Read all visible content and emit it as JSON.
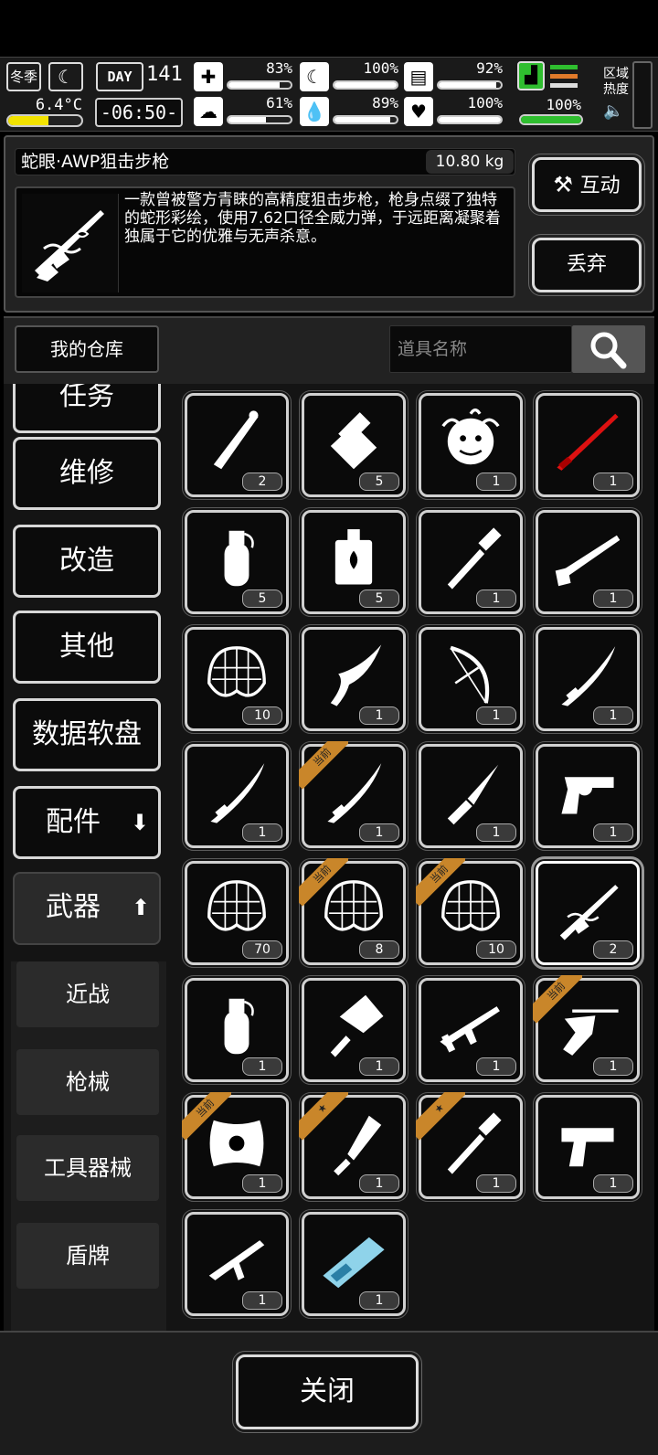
{
  "status": {
    "season": "冬季",
    "temperature": "6.4°C",
    "temperature_level": 0.55,
    "day_label": "DAY",
    "day_number": "141",
    "time": "-06:50-",
    "stats": [
      {
        "icon": "medkit-icon",
        "glyph": "✚",
        "value": "83%",
        "level": 0.83
      },
      {
        "icon": "hunger-icon",
        "glyph": "☾",
        "value": "100%",
        "level": 1.0
      },
      {
        "icon": "energy-icon",
        "glyph": "▤",
        "value": "92%",
        "level": 0.92
      },
      {
        "icon": "mood-icon",
        "glyph": "☁",
        "value": "61%",
        "level": 0.61
      },
      {
        "icon": "water-icon",
        "glyph": "💧",
        "value": "89%",
        "level": 0.89
      },
      {
        "icon": "heart-icon",
        "glyph": "♥",
        "value": "100%",
        "level": 1.0
      }
    ],
    "stamina_value": "100%",
    "stamina_level": 1.0,
    "zone_heat": "区域热度",
    "colors": {
      "green": "#2fbe2f",
      "orange": "#e07a2a",
      "yellow": "#f2e200"
    }
  },
  "item": {
    "name": "蛇眼·AWP狙击步枪",
    "weight": "10.80 kg",
    "description": "一款曾被警方青睐的高精度狙击步枪，枪身点缀了独特的蛇形彩绘，使用7.62口径全威力弹，于远距离凝聚着独属于它的优雅与无声杀意。",
    "interact_label": "互动",
    "discard_label": "丢弃"
  },
  "warehouse": {
    "title": "我的仓库",
    "search_placeholder": "道具名称"
  },
  "categories": [
    {
      "label": "任务"
    },
    {
      "label": "维修"
    },
    {
      "label": "改造"
    },
    {
      "label": "其他"
    },
    {
      "label": "数据软盘"
    },
    {
      "label": "配件",
      "arrow": "⬇"
    },
    {
      "label": "武器",
      "arrow": "⬆"
    }
  ],
  "subcategories": [
    {
      "label": "近战"
    },
    {
      "label": "枪械"
    },
    {
      "label": "工具器械"
    },
    {
      "label": "盾牌"
    }
  ],
  "current_tag": "当前",
  "items": [
    {
      "icon": "bone-club-icon",
      "count": "2"
    },
    {
      "icon": "bottle-icon",
      "count": "5"
    },
    {
      "icon": "medusa-icon",
      "count": "1"
    },
    {
      "icon": "red-katana-icon",
      "count": "1"
    },
    {
      "icon": "grenade-icon",
      "count": "5"
    },
    {
      "icon": "fire-bomb-icon",
      "count": "5"
    },
    {
      "icon": "shovel-icon",
      "count": "1"
    },
    {
      "icon": "shotgun-icon",
      "count": "1"
    },
    {
      "icon": "net-icon",
      "count": "10"
    },
    {
      "icon": "serpent-blade-icon",
      "count": "1"
    },
    {
      "icon": "bow-icon",
      "count": "1"
    },
    {
      "icon": "katana-icon",
      "count": "1"
    },
    {
      "icon": "katana-icon",
      "count": "1"
    },
    {
      "icon": "katana-icon",
      "count": "1",
      "current": true
    },
    {
      "icon": "knife-icon",
      "count": "1"
    },
    {
      "icon": "revolver-icon",
      "count": "1"
    },
    {
      "icon": "net-icon",
      "count": "70"
    },
    {
      "icon": "net-icon",
      "count": "8",
      "current": true
    },
    {
      "icon": "net-icon",
      "count": "10",
      "current": true
    },
    {
      "icon": "awp-rifle-icon",
      "count": "2",
      "selected": true
    },
    {
      "icon": "grenade-icon",
      "count": "1"
    },
    {
      "icon": "cleaver-icon",
      "count": "1"
    },
    {
      "icon": "assault-rifle-icon",
      "count": "1"
    },
    {
      "icon": "crossbow-icon",
      "count": "1",
      "current": true
    },
    {
      "icon": "shield-icon",
      "count": "1",
      "current": true
    },
    {
      "icon": "machete-icon",
      "count": "1",
      "starred": true
    },
    {
      "icon": "shovel-icon",
      "count": "1",
      "starred": true
    },
    {
      "icon": "pistol-icon",
      "count": "1"
    },
    {
      "icon": "smg-icon",
      "count": "1"
    },
    {
      "icon": "plasma-gun-icon",
      "count": "1"
    }
  ],
  "close_label": "关闭"
}
